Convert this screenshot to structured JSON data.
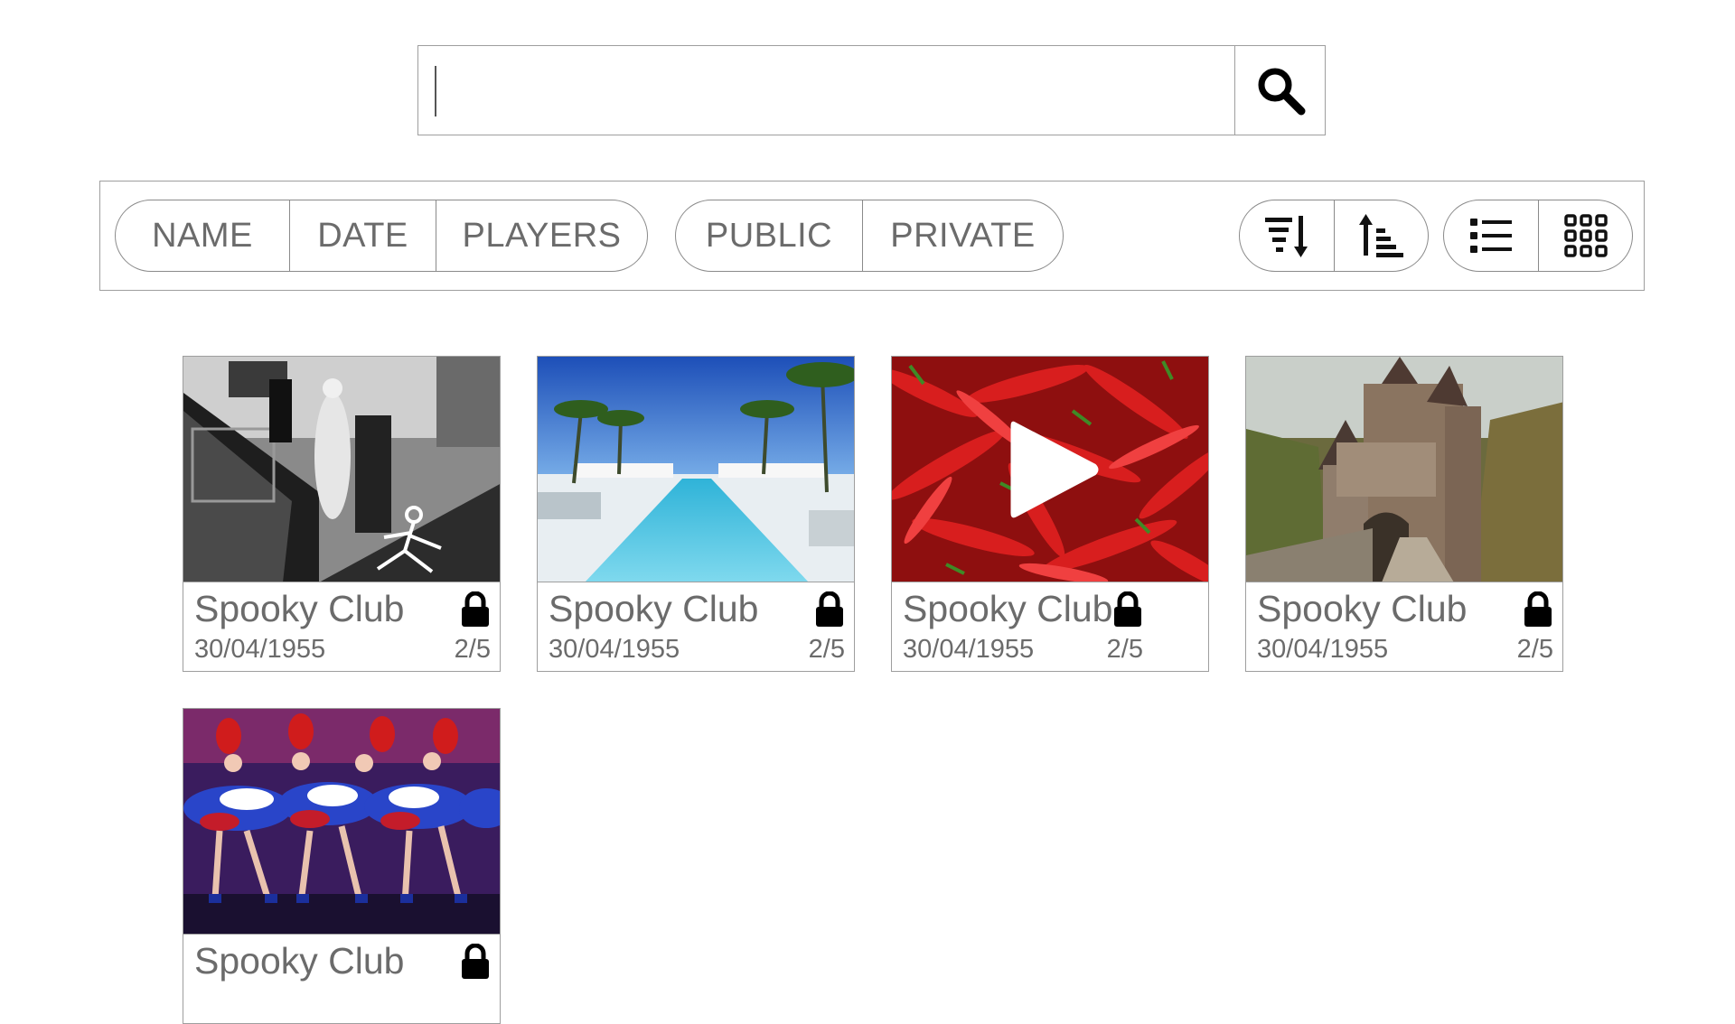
{
  "search": {
    "value": "",
    "placeholder": ""
  },
  "toolbar": {
    "sort_fields": [
      "NAME",
      "DATE",
      "PLAYERS"
    ],
    "visibility": [
      "PUBLIC",
      "PRIVATE"
    ],
    "order_icons": [
      "sort-descending-icon",
      "sort-ascending-icon"
    ],
    "view_icons": [
      "list-view-icon",
      "grid-view-icon"
    ]
  },
  "cards": [
    {
      "title": "Spooky Club",
      "date": "30/04/1955",
      "players": "2/5",
      "locked": true,
      "thumbnail": "haunted-staircase-bw",
      "video": false
    },
    {
      "title": "Spooky Club",
      "date": "30/04/1955",
      "players": "2/5",
      "locked": true,
      "thumbnail": "rooftop-pool-palms",
      "video": false
    },
    {
      "title": "Spooky Club",
      "date": "30/04/1955",
      "players": "2/5",
      "locked": true,
      "thumbnail": "red-chili-peppers",
      "video": true
    },
    {
      "title": "Spooky Club",
      "date": "30/04/1955",
      "players": "2/5",
      "locked": true,
      "thumbnail": "castle-bridge",
      "video": false
    },
    {
      "title": "Spooky Club",
      "date": "",
      "players": "",
      "locked": true,
      "thumbnail": "cancan-dancers",
      "video": false
    }
  ]
}
